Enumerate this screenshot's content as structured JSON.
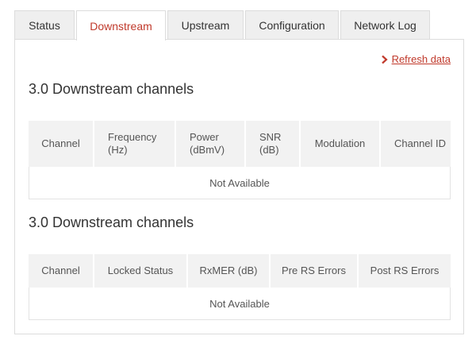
{
  "tabs": [
    {
      "label": "Status",
      "active": false
    },
    {
      "label": "Downstream",
      "active": true
    },
    {
      "label": "Upstream",
      "active": false
    },
    {
      "label": "Configuration",
      "active": false
    },
    {
      "label": "Network Log",
      "active": false
    }
  ],
  "refresh": {
    "label": "Refresh data",
    "icon": "chevron-right-icon"
  },
  "sections": [
    {
      "title": "3.0 Downstream channels",
      "headers": [
        "Channel",
        "Frequency (Hz)",
        "Power (dBmV)",
        "SNR (dB)",
        "Modulation",
        "Channel ID"
      ],
      "empty_text": "Not Available"
    },
    {
      "title": "3.0 Downstream channels",
      "headers": [
        "Channel",
        "Locked Status",
        "RxMER (dB)",
        "Pre RS Errors",
        "Post RS Errors"
      ],
      "empty_text": "Not Available"
    }
  ],
  "colors": {
    "accent": "#c0392b",
    "header_bg": "#f2f2f2",
    "tab_bg": "#efefef"
  }
}
